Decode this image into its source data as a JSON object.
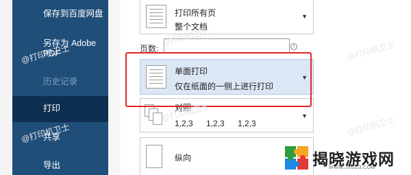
{
  "nav": {
    "items": [
      {
        "label": "保存到百度网盘",
        "state": "normal"
      },
      {
        "label_line1": "另存为 Adobe",
        "label_line2": "PDF",
        "state": "normal"
      },
      {
        "label": "历史记录",
        "state": "disabled"
      },
      {
        "label": "打印",
        "state": "active"
      },
      {
        "label": "共享",
        "state": "normal"
      },
      {
        "label": "导出",
        "state": "normal"
      }
    ]
  },
  "settings": {
    "print_range": {
      "title": "打印所有页",
      "subtitle": "整个文档"
    },
    "pages": {
      "label": "页数:",
      "value": "",
      "info_glyph": "i"
    },
    "sides": {
      "title": "单面打印",
      "subtitle": "仅在纸面的一侧上进行打印"
    },
    "collate": {
      "title": "对照",
      "sequence": [
        "1,2,3",
        "1,2,3",
        "1,2,3"
      ]
    },
    "orientation": {
      "title": "纵向"
    }
  },
  "watermark": {
    "text": "@打印机卫士"
  },
  "brand": {
    "name": "揭晓游戏网",
    "url": "WWW.JXGZ3.COM",
    "colors": [
      "#2e9e3f",
      "#f5a623",
      "#1e88e5",
      "#e53935"
    ]
  },
  "colors": {
    "nav_bg": "#1f4e79",
    "nav_active": "#0f2f52",
    "highlight": "#dbe7f5",
    "annotation": "#e02424"
  }
}
